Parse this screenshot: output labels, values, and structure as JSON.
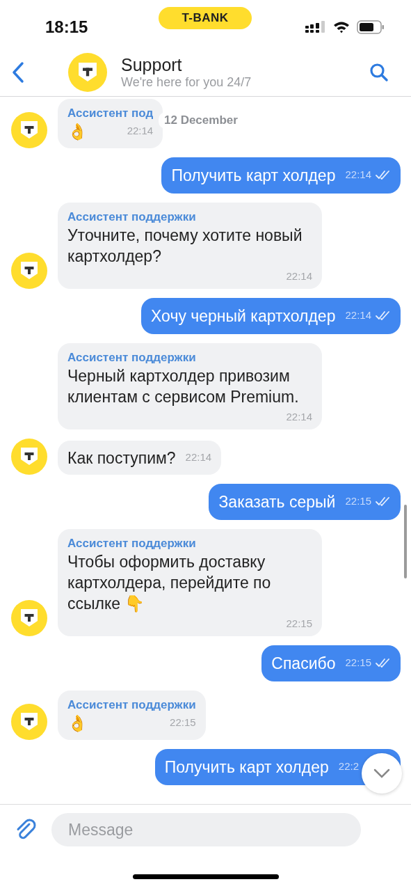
{
  "status_bar": {
    "time": "18:15",
    "badge": "T-BANK"
  },
  "header": {
    "title": "Support",
    "subtitle": "We're here for you 24/7"
  },
  "date_label": "12 December",
  "messages": [
    {
      "kind": "incoming",
      "sender": "Ассистент под",
      "text": "👌",
      "time": "22:14",
      "avatar": true
    },
    {
      "kind": "outgoing",
      "text": "Получить карт холдер",
      "time": "22:14",
      "read": true
    },
    {
      "kind": "incoming",
      "sender": "Ассистент поддержки",
      "text": "Уточните, почему хотите новый картхолдер?",
      "time": "22:14",
      "avatar": true
    },
    {
      "kind": "outgoing",
      "text": "Хочу черный картхолдер",
      "time": "22:14",
      "read": true
    },
    {
      "kind": "incoming",
      "sender": "Ассистент поддержки",
      "text": "Черный картхолдер привозим клиентам с сервисом Premium.",
      "time": "22:14",
      "avatar": false
    },
    {
      "kind": "incoming",
      "text": "Как поступим?",
      "time": "22:14",
      "avatar": true
    },
    {
      "kind": "outgoing",
      "text": "Заказать серый",
      "time": "22:15",
      "read": true
    },
    {
      "kind": "incoming",
      "sender": "Ассистент поддержки",
      "text": "Чтобы оформить доставку картхолдера, перейдите по ссылке 👇",
      "time": "22:15",
      "avatar": true
    },
    {
      "kind": "outgoing",
      "text": "Спасибо",
      "time": "22:15",
      "read": true
    },
    {
      "kind": "incoming",
      "sender": "Ассистент поддержки",
      "text": "👌",
      "time": "22:15",
      "avatar": true
    },
    {
      "kind": "outgoing",
      "text": "Получить карт холдер",
      "time": "22:2"
    }
  ],
  "composer": {
    "placeholder": "Message"
  }
}
